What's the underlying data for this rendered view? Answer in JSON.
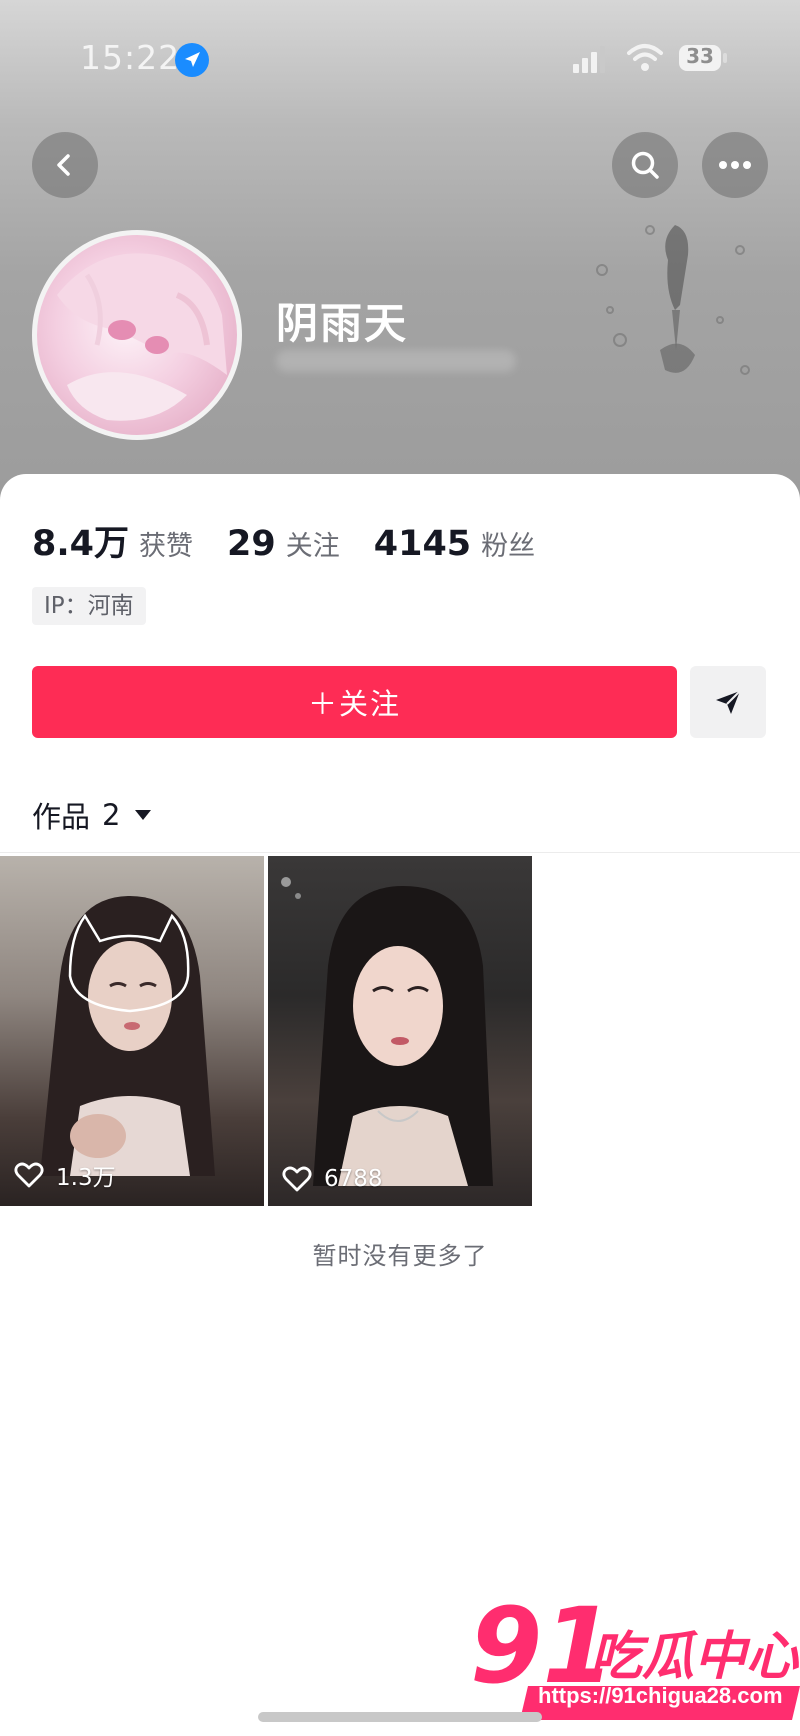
{
  "status_bar": {
    "time": "15:22",
    "battery": "33"
  },
  "header": {
    "back_icon": "chevron-left-icon",
    "search_icon": "search-icon",
    "more_icon": "more-dots-icon",
    "username": "阴雨天"
  },
  "stats": [
    {
      "value": "8.4万",
      "label": "获赞"
    },
    {
      "value": "29",
      "label": "关注"
    },
    {
      "value": "4145",
      "label": "粉丝"
    }
  ],
  "ip_tag": "IP：河南",
  "actions": {
    "follow_label": "＋关注",
    "share_icon": "send-icon"
  },
  "works_tab": {
    "label": "作品",
    "count": "2"
  },
  "works": [
    {
      "likes": "1.3万"
    },
    {
      "likes": "6788"
    }
  ],
  "footer_text": "暂时没有更多了",
  "watermark": {
    "url": "https://91chigua28.com"
  },
  "colors": {
    "accent": "#fe2c55",
    "text_primary": "#161823",
    "text_secondary": "#6b6d75"
  }
}
